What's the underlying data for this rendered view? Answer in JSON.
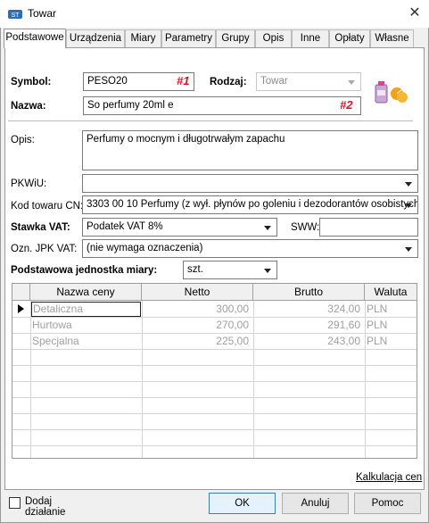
{
  "window": {
    "title": "Towar"
  },
  "tabs": [
    "Podstawowe",
    "Urządzenia",
    "Miary",
    "Parametry",
    "Grupy",
    "Opis",
    "Inne",
    "Opłaty",
    "Własne"
  ],
  "form": {
    "symbol_label": "Symbol:",
    "symbol_value": "PESO20",
    "symbol_tag": "#1",
    "rodzaj_label": "Rodzaj:",
    "rodzaj_value": "Towar",
    "nazwa_label": "Nazwa:",
    "nazwa_value": "So perfumy 20ml e",
    "nazwa_tag": "#2",
    "opis_label": "Opis:",
    "opis_value": "Perfumy o mocnym i długotrwałym zapachu",
    "pkwiu_label": "PKWiU:",
    "pkwiu_value": "",
    "kod_cn_label": "Kod towaru CN:",
    "kod_cn_value": "3303 00 10 Perfumy (z wył. płynów po goleniu i dezodorantów osobistych",
    "vat_label": "Stawka VAT:",
    "vat_value": "Podatek VAT 8%",
    "sww_label": "SWW:",
    "sww_value": "",
    "jpk_label": "Ozn. JPK VAT:",
    "jpk_value": "(nie wymaga oznaczenia)",
    "unit_label": "Podstawowa jednostka miary:",
    "unit_value": "szt."
  },
  "price_table": {
    "columns": [
      "Nazwa ceny",
      "Netto",
      "Brutto",
      "Waluta"
    ],
    "rows": [
      {
        "name": "Detaliczna",
        "netto": "300,00",
        "brutto": "324,00",
        "currency": "PLN"
      },
      {
        "name": "Hurtowa",
        "netto": "270,00",
        "brutto": "291,60",
        "currency": "PLN"
      },
      {
        "name": "Specjalna",
        "netto": "225,00",
        "brutto": "243,00",
        "currency": "PLN"
      }
    ]
  },
  "links": {
    "kalkulacja": "Kalkulacja cen"
  },
  "footer": {
    "add_action_label": "Dodaj działanie",
    "ok": "OK",
    "cancel": "Anuluj",
    "help": "Pomoc"
  },
  "colors": {
    "tag": "#e0102a",
    "accent": "#3c7fb1"
  },
  "icons": {
    "app": "app-logo-icon",
    "close": "close-icon",
    "product": "perfume-product-icon"
  }
}
